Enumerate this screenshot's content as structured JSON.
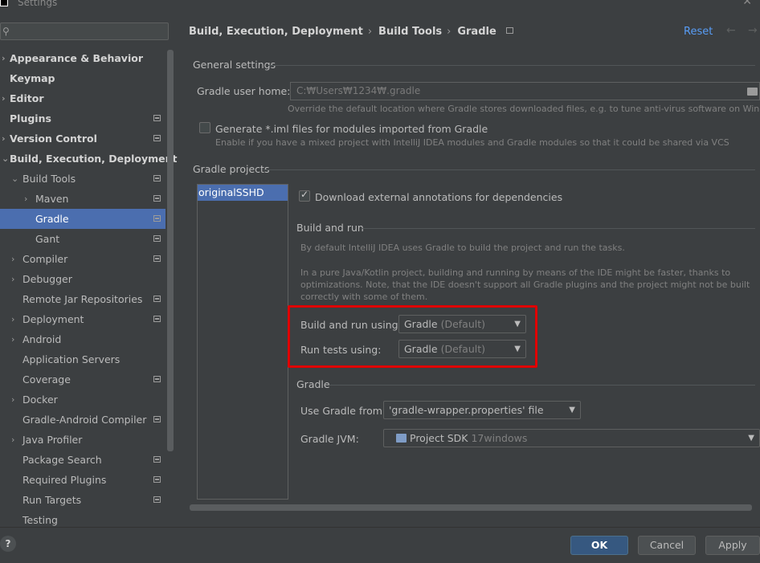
{
  "window": {
    "title": "Settings"
  },
  "search": {
    "placeholder": ""
  },
  "sidebar": {
    "items": [
      {
        "label": "Appearance & Behavior",
        "level": 0,
        "arrow": "›",
        "bold": true,
        "page_icon": false,
        "selected": false
      },
      {
        "label": "Keymap",
        "level": 0,
        "arrow": "",
        "bold": true,
        "page_icon": false,
        "selected": false
      },
      {
        "label": "Editor",
        "level": 0,
        "arrow": "›",
        "bold": true,
        "page_icon": false,
        "selected": false
      },
      {
        "label": "Plugins",
        "level": 0,
        "arrow": "",
        "bold": true,
        "page_icon": true,
        "selected": false
      },
      {
        "label": "Version Control",
        "level": 0,
        "arrow": "›",
        "bold": true,
        "page_icon": true,
        "selected": false
      },
      {
        "label": "Build, Execution, Deployment",
        "level": 0,
        "arrow": "⌄",
        "bold": true,
        "page_icon": false,
        "selected": false
      },
      {
        "label": "Build Tools",
        "level": 1,
        "arrow": "⌄",
        "bold": false,
        "page_icon": true,
        "selected": false
      },
      {
        "label": "Maven",
        "level": 2,
        "arrow": "›",
        "bold": false,
        "page_icon": true,
        "selected": false
      },
      {
        "label": "Gradle",
        "level": 2,
        "arrow": "",
        "bold": false,
        "page_icon": true,
        "selected": true
      },
      {
        "label": "Gant",
        "level": 2,
        "arrow": "",
        "bold": false,
        "page_icon": true,
        "selected": false
      },
      {
        "label": "Compiler",
        "level": 1,
        "arrow": "›",
        "bold": false,
        "page_icon": true,
        "selected": false
      },
      {
        "label": "Debugger",
        "level": 1,
        "arrow": "›",
        "bold": false,
        "page_icon": false,
        "selected": false
      },
      {
        "label": "Remote Jar Repositories",
        "level": 1,
        "arrow": "",
        "bold": false,
        "page_icon": true,
        "selected": false
      },
      {
        "label": "Deployment",
        "level": 1,
        "arrow": "›",
        "bold": false,
        "page_icon": true,
        "selected": false
      },
      {
        "label": "Android",
        "level": 1,
        "arrow": "›",
        "bold": false,
        "page_icon": false,
        "selected": false
      },
      {
        "label": "Application Servers",
        "level": 1,
        "arrow": "",
        "bold": false,
        "page_icon": false,
        "selected": false
      },
      {
        "label": "Coverage",
        "level": 1,
        "arrow": "",
        "bold": false,
        "page_icon": true,
        "selected": false
      },
      {
        "label": "Docker",
        "level": 1,
        "arrow": "›",
        "bold": false,
        "page_icon": false,
        "selected": false
      },
      {
        "label": "Gradle-Android Compiler",
        "level": 1,
        "arrow": "",
        "bold": false,
        "page_icon": true,
        "selected": false
      },
      {
        "label": "Java Profiler",
        "level": 1,
        "arrow": "›",
        "bold": false,
        "page_icon": false,
        "selected": false
      },
      {
        "label": "Package Search",
        "level": 1,
        "arrow": "",
        "bold": false,
        "page_icon": true,
        "selected": false
      },
      {
        "label": "Required Plugins",
        "level": 1,
        "arrow": "",
        "bold": false,
        "page_icon": true,
        "selected": false
      },
      {
        "label": "Run Targets",
        "level": 1,
        "arrow": "",
        "bold": false,
        "page_icon": true,
        "selected": false
      },
      {
        "label": "Testing",
        "level": 1,
        "arrow": "",
        "bold": false,
        "page_icon": false,
        "selected": false
      }
    ]
  },
  "breadcrumb": {
    "items": [
      "Build, Execution, Deployment",
      "Build Tools",
      "Gradle"
    ],
    "separator": "›"
  },
  "header": {
    "reset_label": "Reset",
    "back_icon": "←",
    "forward_icon": "→"
  },
  "general": {
    "title": "General settings",
    "user_home_label": "Gradle user home:",
    "user_home_value": "C:₩Users₩1234₩.gradle",
    "user_home_hint": "Override the default location where Gradle stores downloaded files, e.g. to tune anti-virus software on Windows",
    "generate_iml_label": "Generate *.iml files for modules imported from Gradle",
    "generate_iml_checked": false,
    "generate_iml_hint": "Enable if you have a mixed project with IntelliJ IDEA modules and Gradle modules so that it could be shared via VCS"
  },
  "projects": {
    "title": "Gradle projects",
    "list": [
      "originalSSHD"
    ],
    "download_annotations_label": "Download external annotations for dependencies",
    "download_annotations_checked": true,
    "check_glyph": "✓"
  },
  "build_and_run": {
    "title": "Build and run",
    "desc1": "By default IntelliJ IDEA uses Gradle to build the project and run the tasks.",
    "desc2_line1": "In a pure Java/Kotlin project, building and running by means of the IDE might be faster, thanks to",
    "desc2_line2": "optimizations. Note, that the IDE doesn't support all Gradle plugins and the project might not be built",
    "desc2_line3": "correctly with some of them.",
    "build_using_label": "Build and run using:",
    "build_using_value": "Gradle",
    "build_using_suffix": "(Default)",
    "tests_using_label": "Run tests using:",
    "tests_using_value": "Gradle",
    "tests_using_suffix": "(Default)",
    "caret": "▼"
  },
  "gradle": {
    "title": "Gradle",
    "use_from_label": "Use Gradle from:",
    "use_from_value": "'gradle-wrapper.properties' file",
    "jvm_label": "Gradle JVM:",
    "jvm_value": "Project SDK",
    "jvm_suffix": "17windows"
  },
  "footer": {
    "help_label": "?",
    "ok_label": "OK",
    "cancel_label": "Cancel",
    "apply_label": "Apply"
  },
  "colors": {
    "background": "#3c3f41",
    "selection": "#4b6eaf",
    "link": "#589df6",
    "highlight_border": "#e00000",
    "primary_button": "#365880"
  }
}
